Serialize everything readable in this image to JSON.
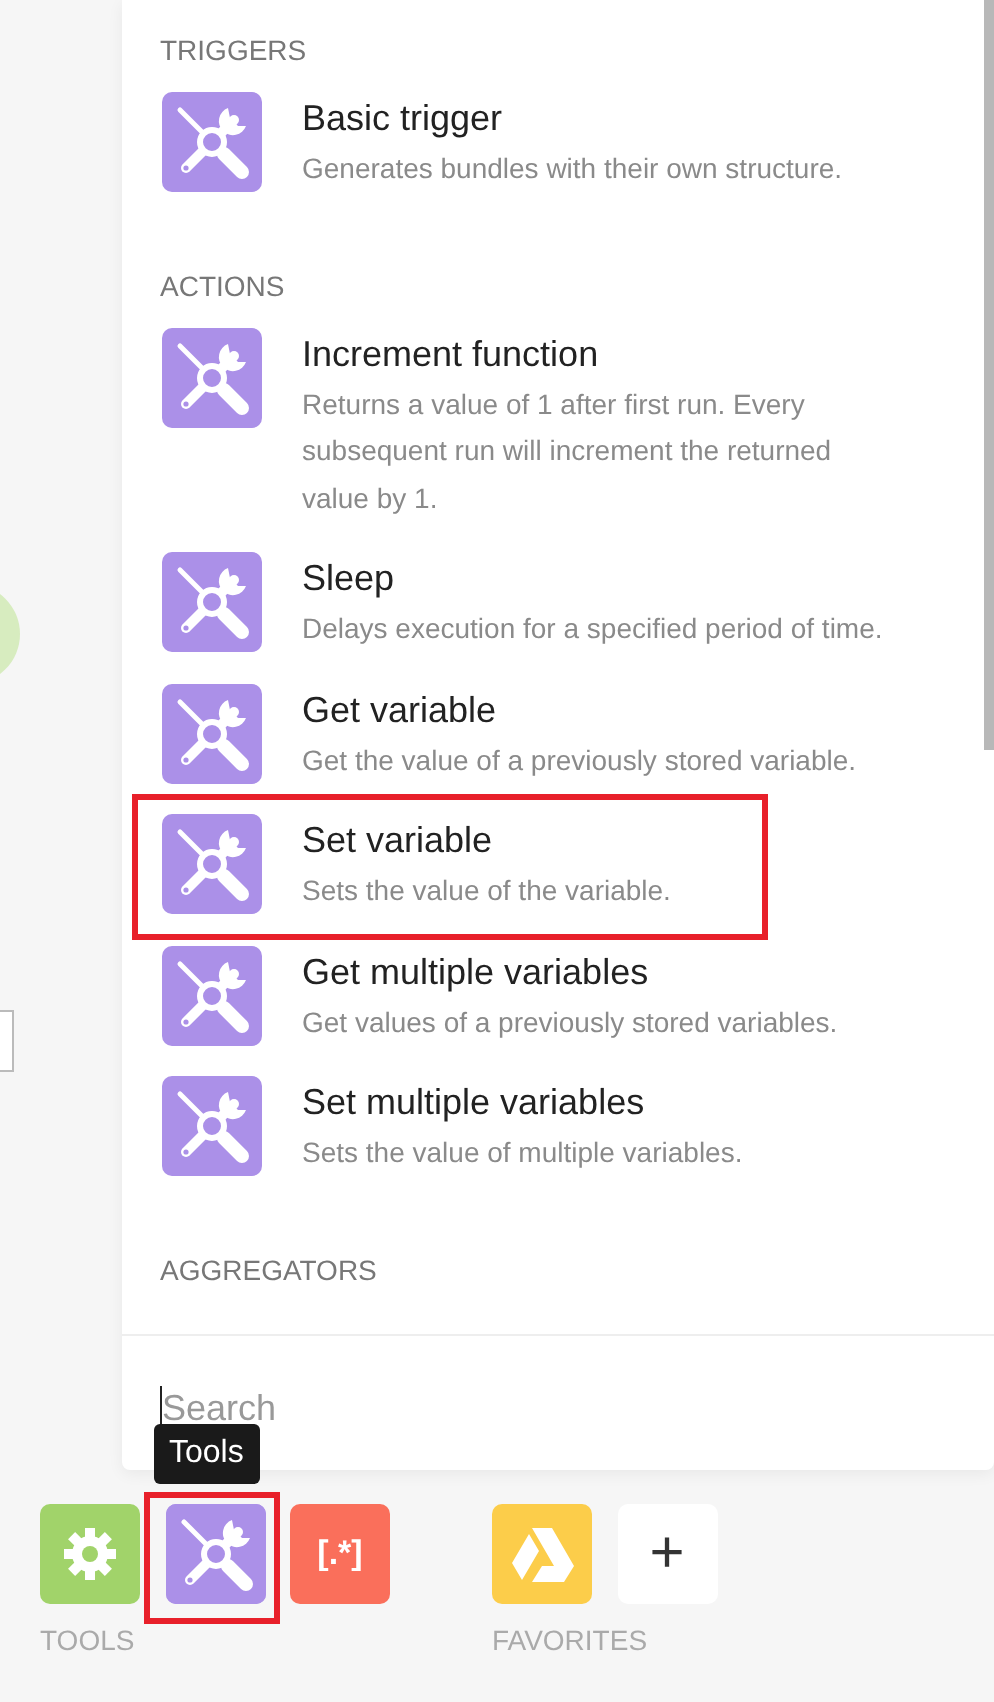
{
  "panel": {
    "sections": [
      {
        "heading": "TRIGGERS",
        "items": [
          {
            "title": "Basic trigger",
            "description": "Generates bundles with their own structure.",
            "highlighted": false
          }
        ]
      },
      {
        "heading": "ACTIONS",
        "items": [
          {
            "title": "Increment function",
            "description": "Returns a value of 1 after first run. Every subsequent run will increment the returned value by 1.",
            "highlighted": false
          },
          {
            "title": "Sleep",
            "description": "Delays execution for a specified period of time.",
            "highlighted": false
          },
          {
            "title": "Get variable",
            "description": "Get the value of a previously stored variable.",
            "highlighted": false
          },
          {
            "title": "Set variable",
            "description": "Sets the value of the variable.",
            "highlighted": true
          },
          {
            "title": "Get multiple variables",
            "description": "Get values of a previously stored variables.",
            "highlighted": false
          },
          {
            "title": "Set multiple variables",
            "description": "Sets the value of multiple variables.",
            "highlighted": false
          }
        ]
      },
      {
        "heading": "AGGREGATORS"
      }
    ],
    "search": {
      "placeholder": "Search"
    }
  },
  "tooltip": "Tools",
  "dock": {
    "groups": [
      {
        "label": "TOOLS",
        "apps": [
          {
            "kind": "gear",
            "color": "#a1d36a",
            "highlighted": false
          },
          {
            "kind": "tools",
            "color": "#ab90e8",
            "highlighted": true
          },
          {
            "kind": "text",
            "glyph": "[.*]",
            "color": "#fa6f5b",
            "highlighted": false
          }
        ]
      },
      {
        "label": "FAVORITES",
        "apps": [
          {
            "kind": "drive",
            "color": "#fccd4a",
            "highlighted": false
          },
          {
            "kind": "text",
            "glyph": "+",
            "color": "#ffffff",
            "highlighted": false
          }
        ]
      }
    ]
  }
}
